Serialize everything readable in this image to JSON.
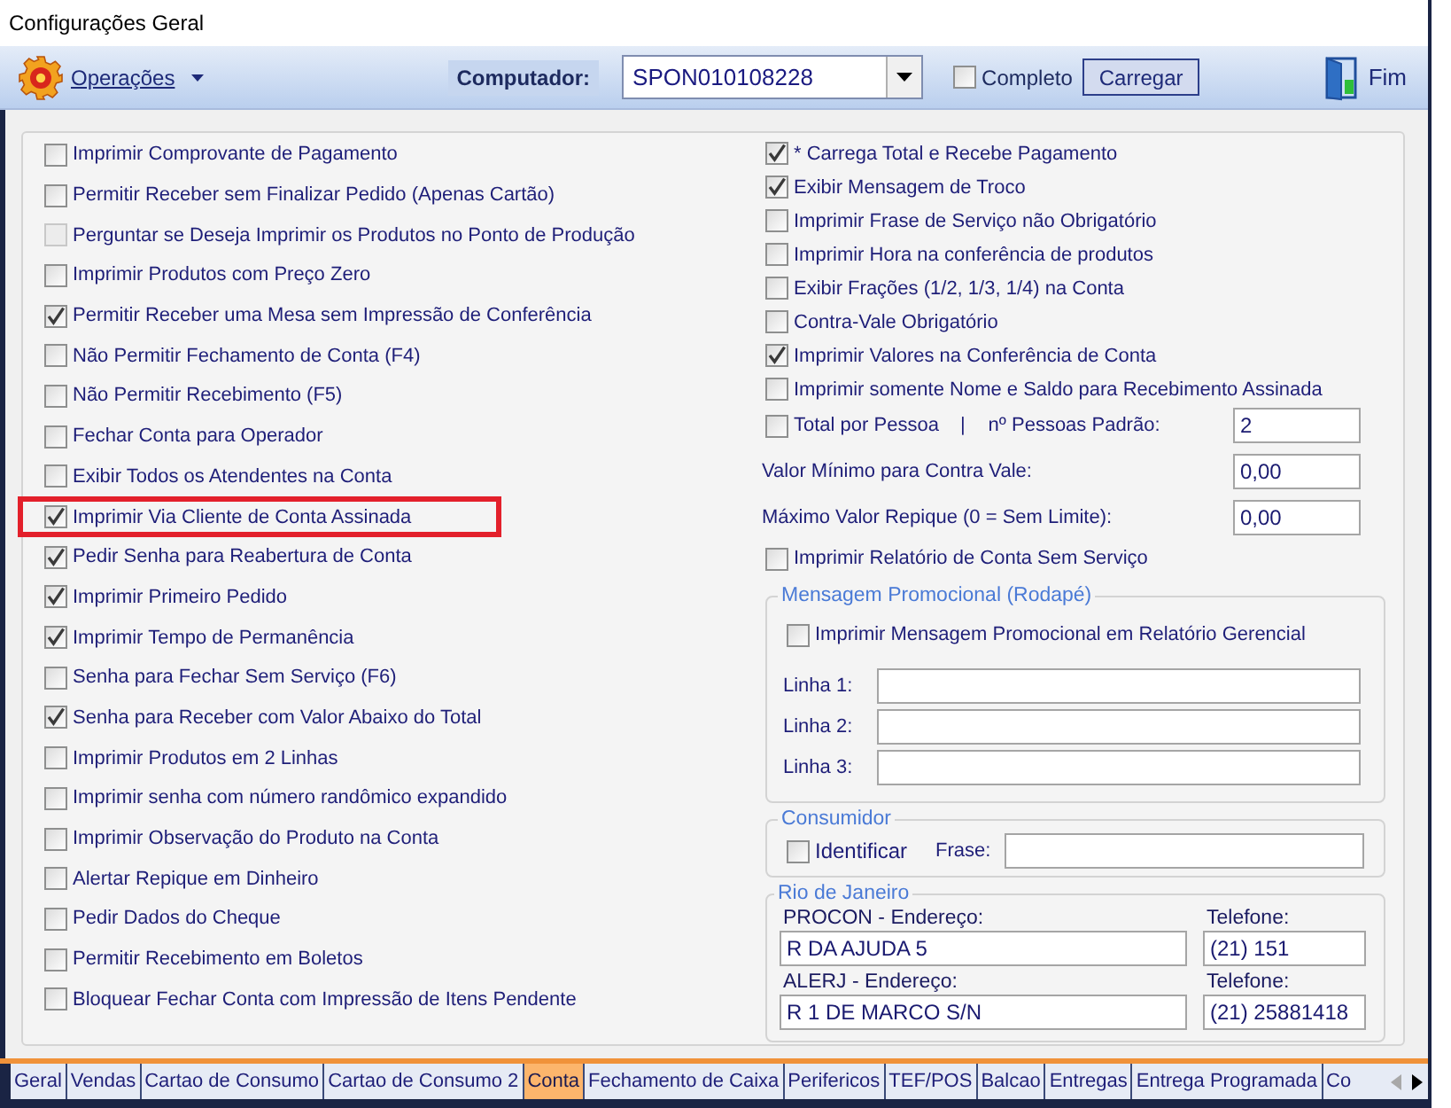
{
  "window": {
    "title": "Configurações Geral"
  },
  "toolbar": {
    "menu": {
      "label": "Operações"
    },
    "computer": {
      "label": "Computador:",
      "value": "SPON010108228"
    },
    "complete": {
      "label": "Completo",
      "checked": false
    },
    "load_button": "Carregar",
    "exit": {
      "label": "Fim"
    }
  },
  "left_options": [
    {
      "label": "Imprimir Comprovante de Pagamento",
      "checked": false,
      "disabled": false,
      "highlighted": false
    },
    {
      "label": "Permitir Receber sem Finalizar Pedido (Apenas Cartão)",
      "checked": false,
      "disabled": false,
      "highlighted": false
    },
    {
      "label": "Perguntar se Deseja Imprimir os Produtos no Ponto de Produção",
      "checked": false,
      "disabled": true,
      "highlighted": false
    },
    {
      "label": "Imprimir Produtos com Preço Zero",
      "checked": false,
      "disabled": false,
      "highlighted": false
    },
    {
      "label": "Permitir Receber uma Mesa sem Impressão de Conferência",
      "checked": true,
      "disabled": false,
      "highlighted": false
    },
    {
      "label": "Não Permitir Fechamento de Conta (F4)",
      "checked": false,
      "disabled": false,
      "highlighted": false
    },
    {
      "label": "Não Permitir Recebimento (F5)",
      "checked": false,
      "disabled": false,
      "highlighted": false
    },
    {
      "label": "Fechar Conta para Operador",
      "checked": false,
      "disabled": false,
      "highlighted": false
    },
    {
      "label": "Exibir Todos os Atendentes na Conta",
      "checked": false,
      "disabled": false,
      "highlighted": false
    },
    {
      "label": "Imprimir Via Cliente de Conta Assinada",
      "checked": true,
      "disabled": false,
      "highlighted": true
    },
    {
      "label": "Pedir Senha para Reabertura de Conta",
      "checked": true,
      "disabled": false,
      "highlighted": false
    },
    {
      "label": "Imprimir Primeiro Pedido",
      "checked": true,
      "disabled": false,
      "highlighted": false
    },
    {
      "label": "Imprimir Tempo de Permanência",
      "checked": true,
      "disabled": false,
      "highlighted": false
    },
    {
      "label": "Senha para Fechar Sem Serviço (F6)",
      "checked": false,
      "disabled": false,
      "highlighted": false
    },
    {
      "label": "Senha para Receber com Valor Abaixo do Total",
      "checked": true,
      "disabled": false,
      "highlighted": false
    },
    {
      "label": "Imprimir Produtos em 2 Linhas",
      "checked": false,
      "disabled": false,
      "highlighted": false
    },
    {
      "label": "Imprimir senha com número randômico expandido",
      "checked": false,
      "disabled": false,
      "highlighted": false
    },
    {
      "label": "Imprimir Observação do Produto na Conta",
      "checked": false,
      "disabled": false,
      "highlighted": false
    },
    {
      "label": "Alertar Repique em Dinheiro",
      "checked": false,
      "disabled": false,
      "highlighted": false
    },
    {
      "label": "Pedir Dados do Cheque",
      "checked": false,
      "disabled": false,
      "highlighted": false
    },
    {
      "label": "Permitir Recebimento em Boletos",
      "checked": false,
      "disabled": false,
      "highlighted": false
    },
    {
      "label": "Bloquear Fechar Conta com Impressão de Itens Pendente",
      "checked": false,
      "disabled": false,
      "highlighted": false
    }
  ],
  "right_options": [
    {
      "kind": "checkbox",
      "label": "* Carrega Total e Recebe Pagamento",
      "checked": true
    },
    {
      "kind": "checkbox",
      "label": "Exibir Mensagem de Troco",
      "checked": true
    },
    {
      "kind": "checkbox",
      "label": "Imprimir Frase de Serviço não Obrigatório",
      "checked": false
    },
    {
      "kind": "checkbox",
      "label": "Imprimir Hora na conferência de produtos",
      "checked": false
    },
    {
      "kind": "checkbox",
      "label": "Exibir Frações (1/2, 1/3, 1/4) na Conta",
      "checked": false
    },
    {
      "kind": "checkbox",
      "label": "Contra-Vale Obrigatório",
      "checked": false
    },
    {
      "kind": "checkbox",
      "label": "Imprimir Valores na Conferência de Conta",
      "checked": true
    },
    {
      "kind": "checkbox",
      "label": "Imprimir somente Nome e Saldo para Recebimento Assinada",
      "checked": false
    },
    {
      "kind": "checkbox-field",
      "label": "Total por Pessoa",
      "checked": false,
      "separator": "|",
      "field_label": "nº Pessoas Padrão:",
      "value": "2"
    },
    {
      "kind": "field",
      "label": "Valor Mínimo para Contra Vale:",
      "value": "0,00"
    },
    {
      "kind": "field",
      "label": "Máximo Valor Repique (0 = Sem Limite):",
      "value": "0,00"
    },
    {
      "kind": "checkbox",
      "label": "Imprimir Relatório de Conta Sem Serviço",
      "checked": false
    }
  ],
  "promo_group": {
    "title": "Mensagem Promocional (Rodapé)",
    "checkbox": {
      "label": "Imprimir Mensagem Promocional em Relatório Gerencial",
      "checked": false
    },
    "lines": [
      {
        "label": "Linha 1:"
      },
      {
        "label": "Linha 2:"
      },
      {
        "label": "Linha 3:"
      }
    ]
  },
  "consumer_group": {
    "title": "Consumidor",
    "checkbox": {
      "label": "Identificar",
      "checked": false
    },
    "field_label": "Frase:"
  },
  "region_group": {
    "title": "Rio de Janeiro",
    "contacts": [
      {
        "address_label": "PROCON - Endereço:",
        "address": "R DA AJUDA 5",
        "phone_label": "Telefone:",
        "phone": "(21) 151"
      },
      {
        "address_label": "ALERJ - Endereço:",
        "address": "R 1 DE MARCO S/N",
        "phone_label": "Telefone:",
        "phone": "(21) 25881418"
      }
    ]
  },
  "tabs": [
    {
      "label": "Geral",
      "selected": false
    },
    {
      "label": "Vendas",
      "selected": false
    },
    {
      "label": "Cartao de Consumo",
      "selected": false
    },
    {
      "label": "Cartao de Consumo 2",
      "selected": false
    },
    {
      "label": "Conta",
      "selected": true
    },
    {
      "label": "Fechamento de Caixa",
      "selected": false
    },
    {
      "label": "Perifericos",
      "selected": false
    },
    {
      "label": "TEF/POS",
      "selected": false
    },
    {
      "label": "Balcao",
      "selected": false
    },
    {
      "label": "Entregas",
      "selected": false
    },
    {
      "label": "Entrega Programada",
      "selected": false
    },
    {
      "label": "Co",
      "selected": false
    }
  ],
  "tab_scroll": [
    {
      "kind": "left",
      "disabled": true
    },
    {
      "kind": "right",
      "disabled": false
    }
  ]
}
